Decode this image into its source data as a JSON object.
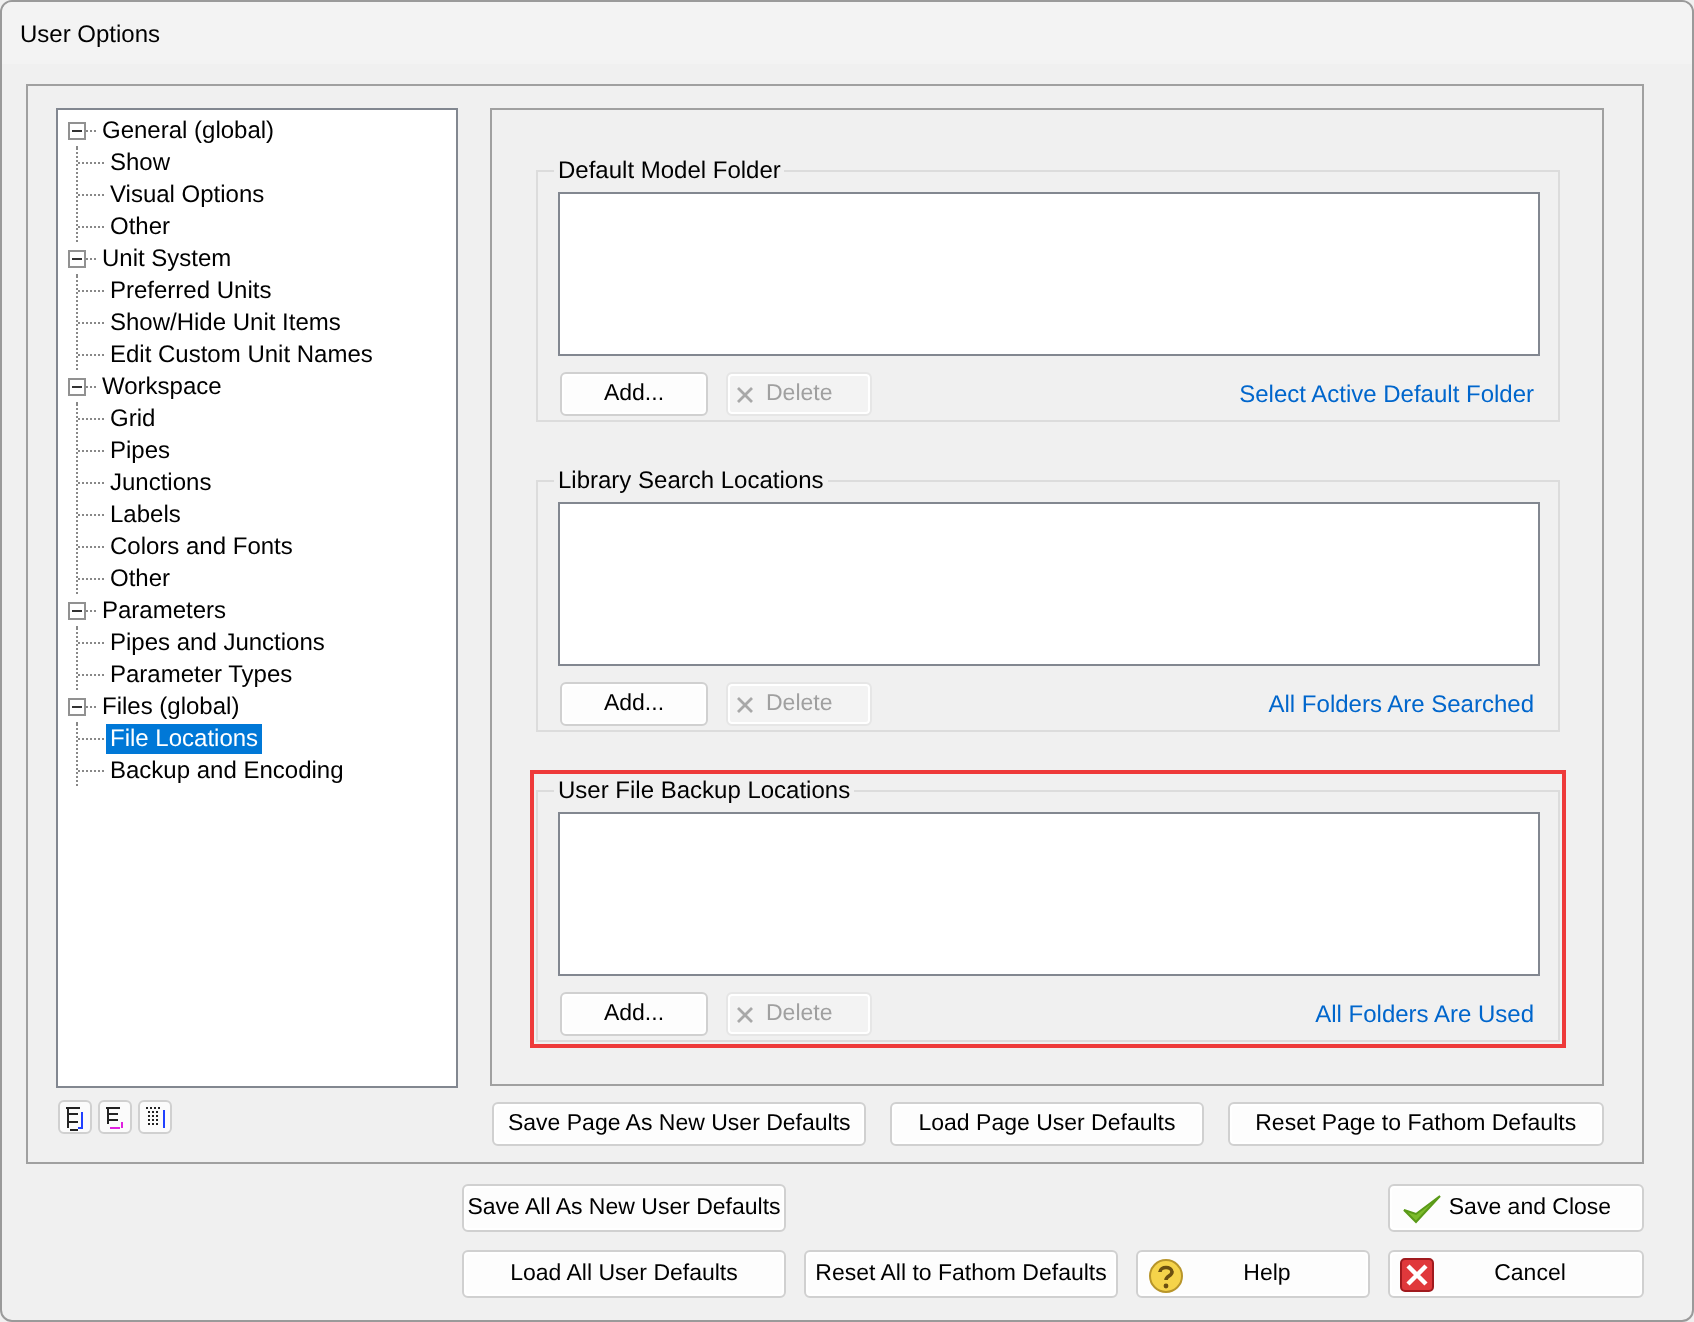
{
  "window": {
    "title": "User Options"
  },
  "tree": [
    {
      "label": "General (global)",
      "expanded": true,
      "selected": false,
      "children": [
        {
          "label": "Show",
          "selected": false
        },
        {
          "label": "Visual Options",
          "selected": false
        },
        {
          "label": "Other",
          "selected": false
        }
      ]
    },
    {
      "label": "Unit System",
      "expanded": true,
      "selected": false,
      "children": [
        {
          "label": "Preferred Units",
          "selected": false
        },
        {
          "label": "Show/Hide Unit Items",
          "selected": false
        },
        {
          "label": "Edit Custom Unit Names",
          "selected": false
        }
      ]
    },
    {
      "label": "Workspace",
      "expanded": true,
      "selected": false,
      "children": [
        {
          "label": "Grid",
          "selected": false
        },
        {
          "label": "Pipes",
          "selected": false
        },
        {
          "label": "Junctions",
          "selected": false
        },
        {
          "label": "Labels",
          "selected": false
        },
        {
          "label": "Colors and Fonts",
          "selected": false
        },
        {
          "label": "Other",
          "selected": false
        }
      ]
    },
    {
      "label": "Parameters",
      "expanded": true,
      "selected": false,
      "children": [
        {
          "label": "Pipes and Junctions",
          "selected": false
        },
        {
          "label": "Parameter Types",
          "selected": false
        }
      ]
    },
    {
      "label": "Files (global)",
      "expanded": true,
      "selected": false,
      "children": [
        {
          "label": "File Locations",
          "selected": true
        },
        {
          "label": "Backup and Encoding",
          "selected": false
        }
      ]
    }
  ],
  "groups": [
    {
      "title": "Default Model Folder",
      "highlighted": false,
      "buttons": [
        {
          "label": "Add...",
          "kind": "add",
          "disabled": false
        },
        {
          "label": "Delete",
          "kind": "delete",
          "disabled": true
        }
      ],
      "link": "Select Active Default Folder"
    },
    {
      "title": "Library Search Locations",
      "highlighted": false,
      "buttons": [
        {
          "label": "Add...",
          "kind": "add",
          "disabled": false
        },
        {
          "label": "Delete",
          "kind": "delete",
          "disabled": true
        }
      ],
      "link": "All Folders Are Searched"
    },
    {
      "title": "User File Backup Locations",
      "highlighted": true,
      "buttons": [
        {
          "label": "Add...",
          "kind": "add",
          "disabled": false
        },
        {
          "label": "Delete",
          "kind": "delete",
          "disabled": true
        }
      ],
      "link": "All Folders Are Used"
    }
  ],
  "page_buttons": [
    "Save Page As New User Defaults",
    "Load Page User Defaults",
    "Reset Page to Fathom Defaults"
  ],
  "footer": {
    "buttons": [
      {
        "label": "Save All As New User Defaults",
        "kind": "plain"
      },
      {
        "label": "Save and Close",
        "kind": "ok"
      },
      {
        "label": "Load All User Defaults",
        "kind": "plain"
      },
      {
        "label": "Reset All to Fathom Defaults",
        "kind": "plain"
      },
      {
        "label": "Help",
        "kind": "help"
      },
      {
        "label": "Cancel",
        "kind": "cancel"
      }
    ]
  }
}
